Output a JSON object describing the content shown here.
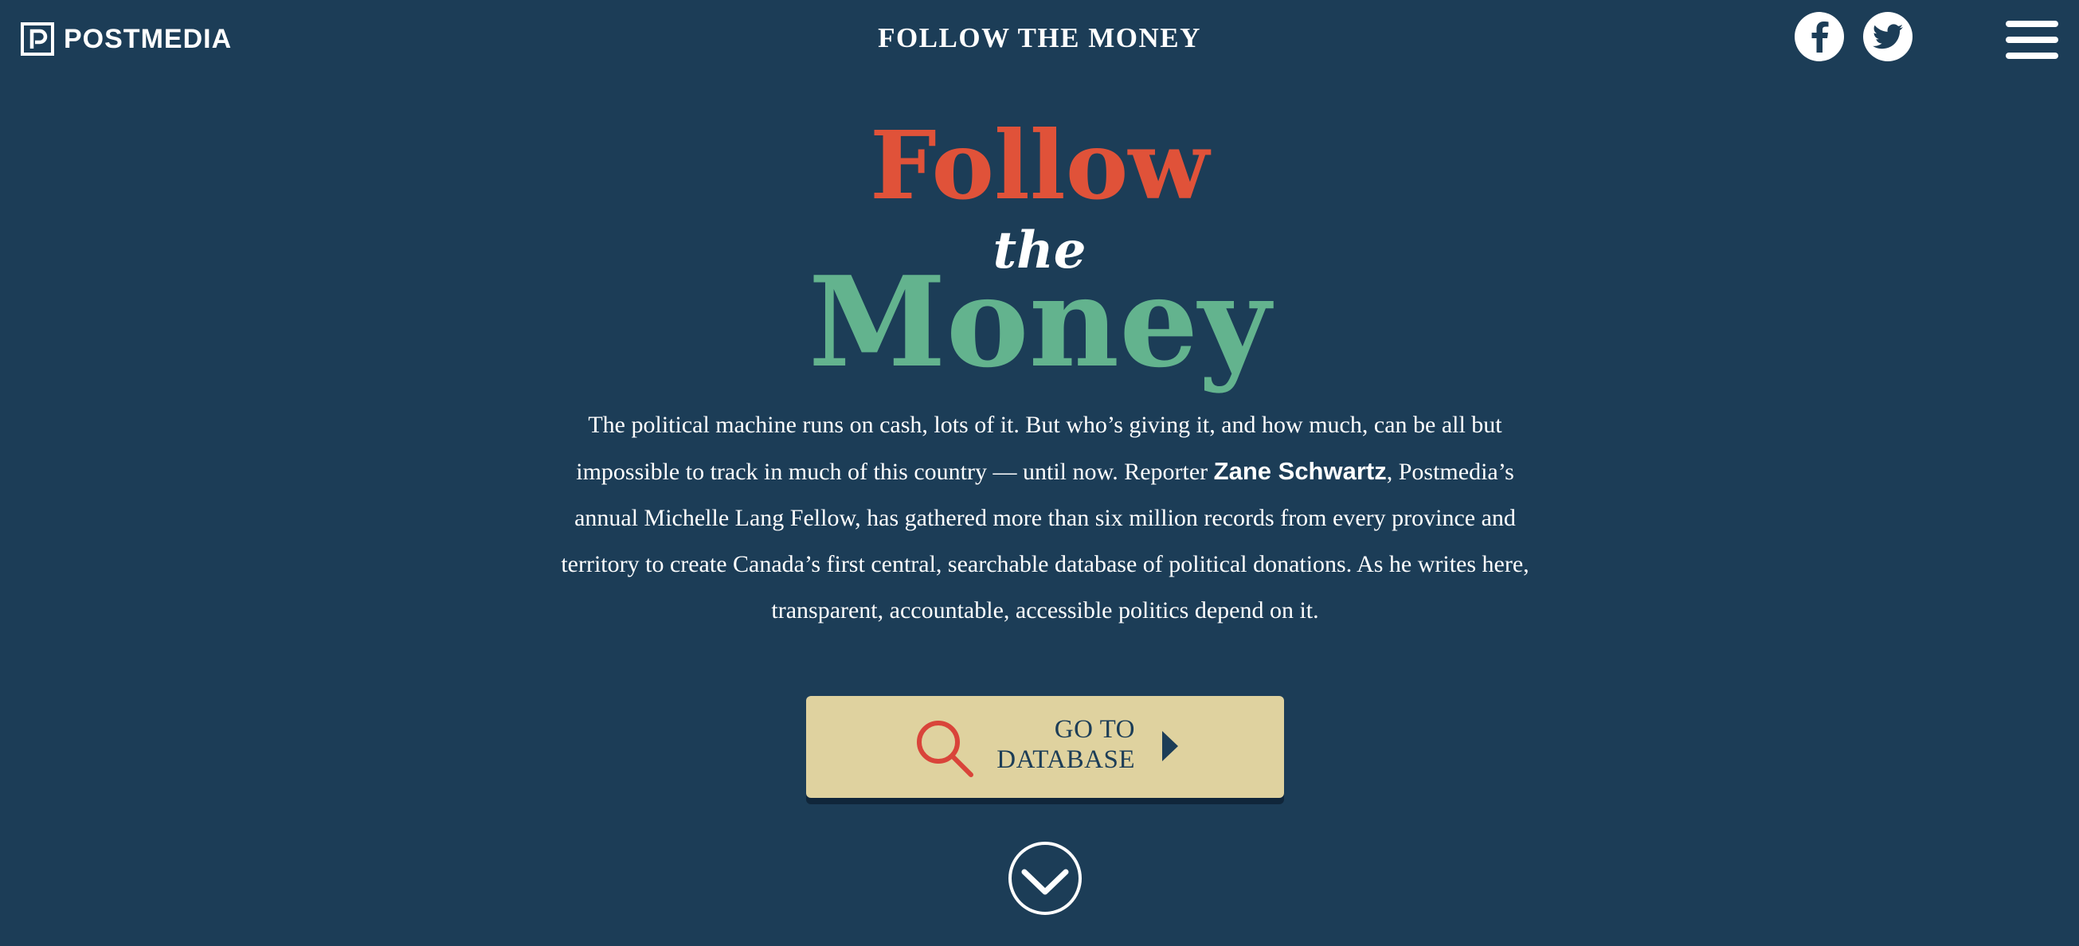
{
  "header": {
    "brand": "POSTMEDIA",
    "site_title": "FOLLOW THE MONEY",
    "social": [
      {
        "name": "facebook",
        "glyph": "f"
      },
      {
        "name": "twitter",
        "icon": "twitter-bird-icon"
      }
    ],
    "menu_icon": "hamburger-menu-icon"
  },
  "hero": {
    "line1": "Follow",
    "line2": "the",
    "line3": "Money",
    "colors": {
      "follow": "#e05239",
      "money": "#63b38e",
      "background": "#1c3d57"
    }
  },
  "intro": {
    "before_name": "The political machine runs on cash, lots of it. But who’s giving it, and how much, can be all but impossible to track in much of this country — until now. Reporter ",
    "name": "Zane Schwartz",
    "after_name": ", Postmedia’s annual Michelle Lang Fellow, has gathered more than six million records from every province and territory to create Canada’s first central, searchable database of political donations. As he writes here, transparent, accountable, accessible politics depend on it."
  },
  "cta": {
    "line1": "GO TO",
    "line2": "DATABASE",
    "icon": "search-icon",
    "arrow_icon": "caret-right-icon",
    "colors": {
      "background": "#dfd29f",
      "icon": "#d9443a",
      "text": "#1c3d57"
    }
  },
  "scroll_icon": "chevron-down-circle-icon"
}
